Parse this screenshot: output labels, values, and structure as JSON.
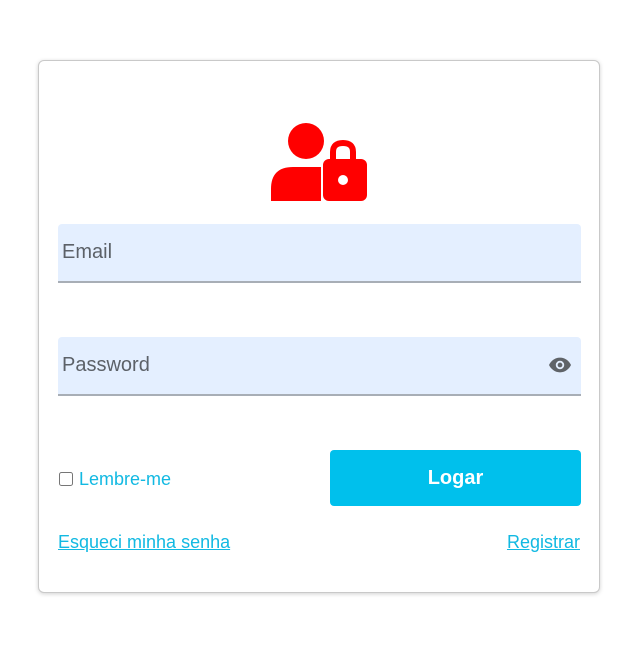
{
  "form": {
    "icon": "user-lock-icon",
    "icon_color": "#ff0000",
    "email": {
      "placeholder": "Email",
      "value": ""
    },
    "password": {
      "placeholder": "Password",
      "value": "",
      "toggle_icon": "eye-icon"
    },
    "remember_label": "Lembre-me",
    "remember_checked": false,
    "login_label": "Logar",
    "forgot_label": "Esqueci minha senha",
    "register_label": "Registrar",
    "accent_color": "#00c0ec",
    "link_color": "#12b9e2"
  }
}
